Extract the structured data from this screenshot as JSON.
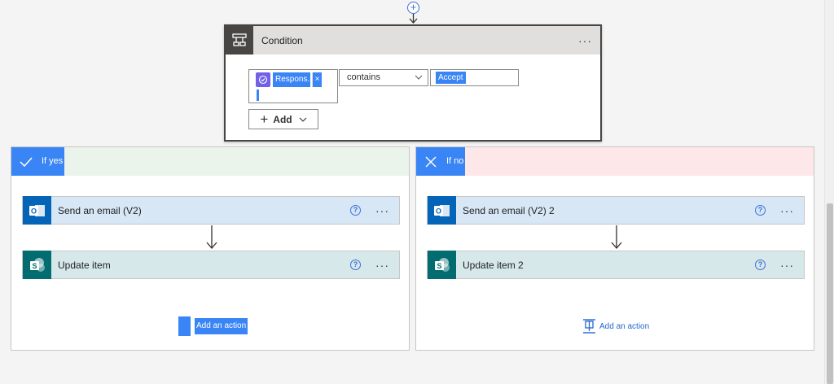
{
  "condition": {
    "title": "Condition",
    "more": "···",
    "token_label": "Respons...",
    "token_remove": "×",
    "operator": "contains",
    "value": "Accept",
    "add_button": "Add"
  },
  "yes_branch": {
    "label": "If yes",
    "actions": [
      {
        "title": "Send an email (V2)",
        "help": "?",
        "more": "···"
      },
      {
        "title": "Update item",
        "help": "?",
        "more": "···"
      }
    ],
    "add_action": "Add an action"
  },
  "no_branch": {
    "label": "If no",
    "actions": [
      {
        "title": "Send an email (V2) 2",
        "help": "?",
        "more": "···"
      },
      {
        "title": "Update item 2",
        "help": "?",
        "more": "···"
      }
    ],
    "add_action": "Add an action"
  },
  "icons": {
    "insert_step": "plus-circle-icon",
    "condition": "condition-icon",
    "outlook": "outlook-icon",
    "sharepoint": "sharepoint-icon",
    "check": "check-icon",
    "cross": "x-icon"
  },
  "colors": {
    "accent": "#3a85f5",
    "condition_header": "#e1dfdd",
    "yes_header": "#ebf4ea",
    "no_header": "#fde7e9",
    "outlook": "#0364b8",
    "sharepoint": "#036c70"
  }
}
